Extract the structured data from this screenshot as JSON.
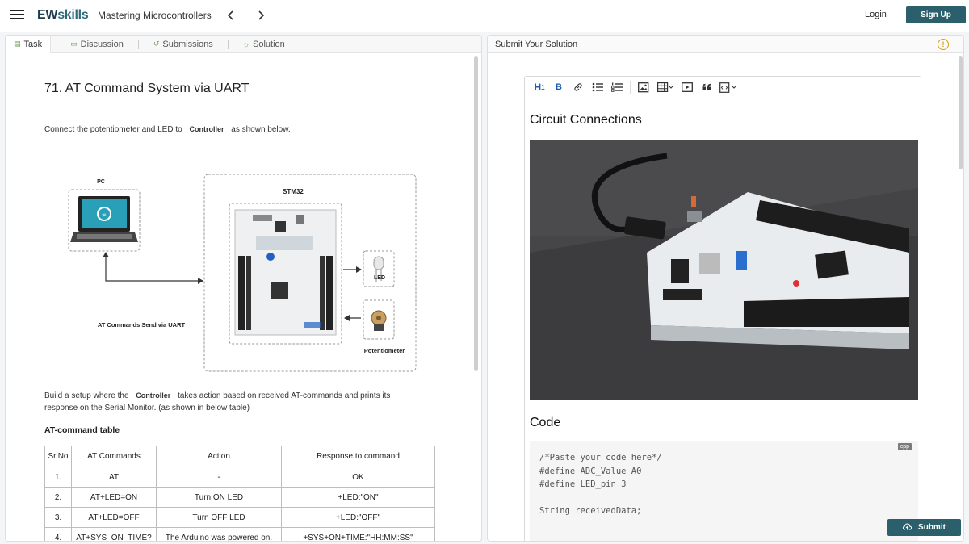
{
  "header": {
    "logo_ew": "EW",
    "logo_skills": "skills",
    "course_title": "Mastering Microcontrollers",
    "prev_arrow": "‹",
    "next_arrow": "›",
    "login": "Login",
    "signup": "Sign Up"
  },
  "tabs": [
    {
      "label": "Task",
      "icon": "task-icon"
    },
    {
      "label": "Discussion",
      "icon": "chat-icon"
    },
    {
      "label": "Submissions",
      "icon": "history-icon"
    },
    {
      "label": "Solution",
      "icon": "bulb-icon"
    }
  ],
  "task": {
    "title": "71. AT Command System via UART",
    "intro_pre": "Connect the ",
    "intro_b1": "potentiometer",
    "intro_mid": " and ",
    "intro_b2": "LED",
    "intro_to": " to ",
    "intro_pill": "Controller",
    "intro_post": " as shown below.",
    "diagram": {
      "pc_label": "PC",
      "board_label": "STM32",
      "uart_label": "AT Commands Send via UART",
      "led_label": "LED",
      "pot_label": "Potentiometer"
    },
    "build_pre": "Build a setup where the ",
    "build_pill": "Controller",
    "build_mid": " takes action based on received ",
    "build_b": "AT-commands",
    "build_post1": " and prints its",
    "build_post2": "response on the Serial Monitor. (as shown in below table)",
    "table_title": "AT-command table",
    "table_headers": [
      "Sr.No",
      "AT Commands",
      "Action",
      "Response to command"
    ],
    "table_rows": [
      [
        "1.",
        "AT",
        "-",
        "OK"
      ],
      [
        "2.",
        "AT+LED=ON",
        "Turn ON LED",
        "+LED:\"ON\""
      ],
      [
        "3.",
        "AT+LED=OFF",
        "Turn OFF LED",
        "+LED:\"OFF\""
      ],
      [
        "4.",
        "AT+SYS_ON_TIME?",
        "The Arduino was powered on.",
        "+SYS+ON+TIME:\"HH:MM:SS\""
      ]
    ]
  },
  "solution": {
    "header": "Submit Your Solution",
    "warn_symbol": "!",
    "heading1": "Circuit Connections",
    "heading2": "Code",
    "code_lang": "cpp",
    "code_lines": [
      "/*Paste your code here*/",
      "#define ADC_Value A0",
      "#define LED_pin 3",
      "",
      "String receivedData;"
    ],
    "submit": "Submit"
  },
  "toolbar": {
    "h1": "H",
    "bold": "B"
  }
}
